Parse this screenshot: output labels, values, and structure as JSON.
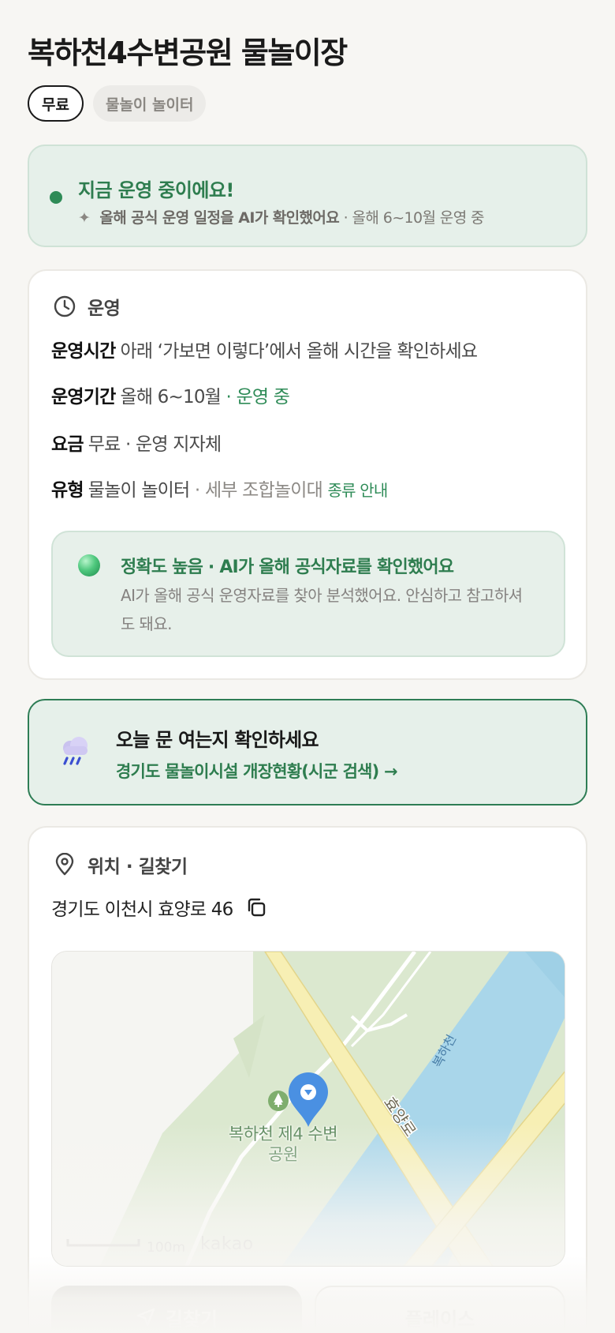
{
  "header": {
    "title": "복하천4수변공원 물놀이장",
    "chips": [
      "무료",
      "물놀이 놀이터"
    ]
  },
  "status": {
    "title": "지금 운영 중이에요!",
    "sub_strong": "올해 공식 운영 일정을 AI가 확인했어요",
    "sub_rest": " · 올해 6~10월 운영 중"
  },
  "operation": {
    "heading": "운영",
    "hours_key": "운영시간",
    "hours_value": "아래 ‘가보면 이렇다’에서 올해 시간을 확인하세요",
    "period_key": "운영기간",
    "period_value": "올해 6~10월",
    "period_status": " · 운영 중",
    "fee_key": "요금",
    "fee_value": "무료 · 운영 지자체",
    "type_key": "유형",
    "type_value": "물놀이 놀이터",
    "type_detail": " · 세부 조합놀이대",
    "type_link": "종류 안내",
    "accuracy_title": "정확도 높음 · AI가 올해 공식자료를 확인했어요",
    "accuracy_desc": "AI가 올해 공식 운영자료를 찾아 분석했어요. 안심하고 참고하셔도 돼요."
  },
  "check": {
    "title": "오늘 문 여는지 확인하세요",
    "link": "경기도 물놀이시설 개장현황(시군 검색) →"
  },
  "location": {
    "heading": "위치 · 길찾기",
    "address": "경기도 이천시 효양로 46",
    "map": {
      "park_label": "복하천 제4 수변공원",
      "road_label": "효양로",
      "river_label": "복하천",
      "scale": "100m",
      "logo": "kakao"
    },
    "buttons": {
      "navigate": "길찾기",
      "place": "플레이스"
    }
  },
  "colors": {
    "accent_green": "#2e7d4f",
    "status_bg": "#e6f0ea",
    "page_bg": "#f7f6f3"
  }
}
